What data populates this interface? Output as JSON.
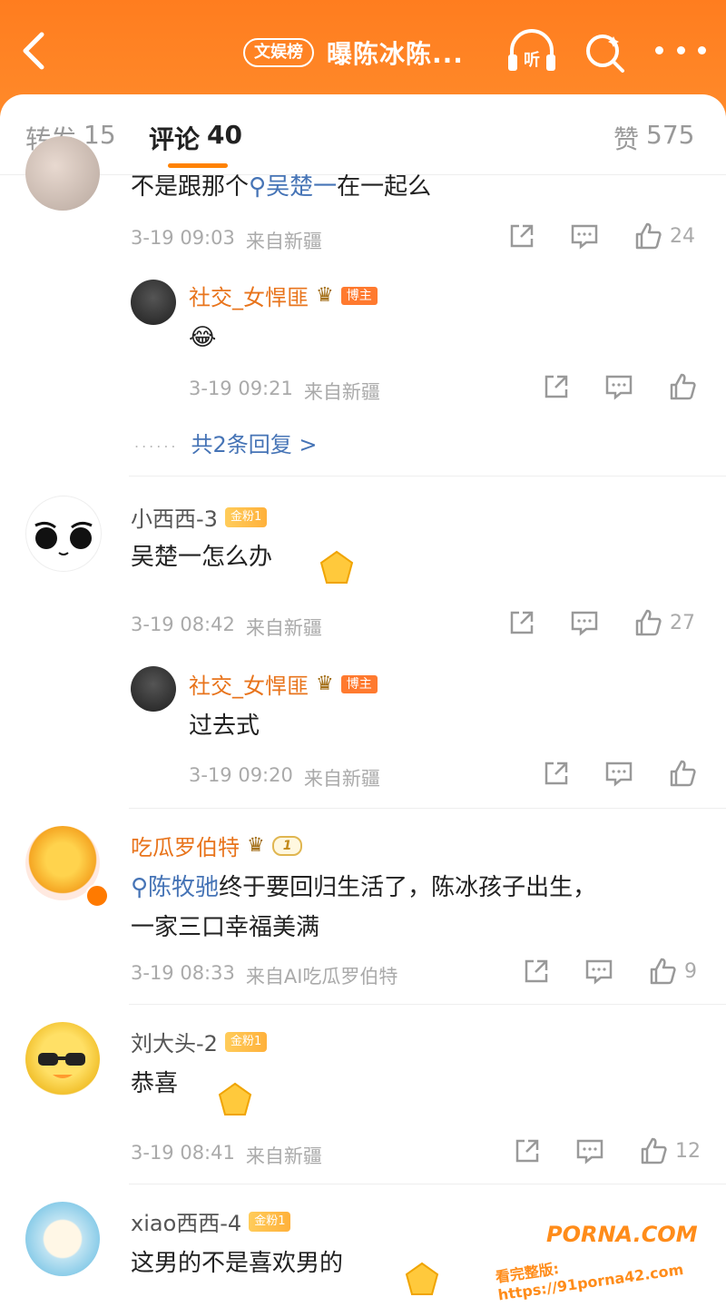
{
  "header": {
    "badge": "文娱榜",
    "title": "曝陈冰陈...",
    "listen_label": "听"
  },
  "tabs": {
    "forward": {
      "label": "转发",
      "count": "15"
    },
    "comment": {
      "label": "评论",
      "count": "40"
    },
    "like": {
      "label": "赞",
      "count": "575"
    }
  },
  "comments": [
    {
      "text_prefix": "不是跟那个",
      "text_link": "吴楚一",
      "text_suffix": "在一起么",
      "time": "3-19 09:03",
      "source": "来自新疆",
      "likes": "24",
      "reply": {
        "name": "社交_女悍匪",
        "badge": "博主",
        "text": "😂",
        "time": "3-19 09:21",
        "source": "来自新疆"
      },
      "more_replies": "共2条回复 >"
    },
    {
      "name": "小西西-3",
      "fan_badge": "金粉1",
      "text": "吴楚一怎么办",
      "time": "3-19 08:42",
      "source": "来自新疆",
      "likes": "27",
      "reply": {
        "name": "社交_女悍匪",
        "badge": "博主",
        "text": "过去式",
        "time": "3-19 09:20",
        "source": "来自新疆"
      }
    },
    {
      "name": "吃瓜罗伯特",
      "level_badge": "1",
      "text_link": "陈牧驰",
      "text_line1": "终于要回归生活了，陈冰孩子出生，",
      "text_line2": "一家三口幸福美满",
      "time": "3-19 08:33",
      "source": "来自AI吃瓜罗伯特",
      "likes": "9"
    },
    {
      "name": "刘大头-2",
      "fan_badge": "金粉1",
      "text": "恭喜",
      "time": "3-19 08:41",
      "source": "来自新疆",
      "likes": "12"
    },
    {
      "name": "xiao西西-4",
      "fan_badge": "金粉1",
      "text": "这男的不是喜欢男的"
    }
  ],
  "watermark": {
    "logo": "PORNA.COM",
    "url": "看完整版: https://91porna42.com"
  },
  "colors": {
    "header": "#ff7d1f",
    "accent": "#ff8200",
    "link": "#4674b6",
    "name_orange": "#e8741c"
  }
}
